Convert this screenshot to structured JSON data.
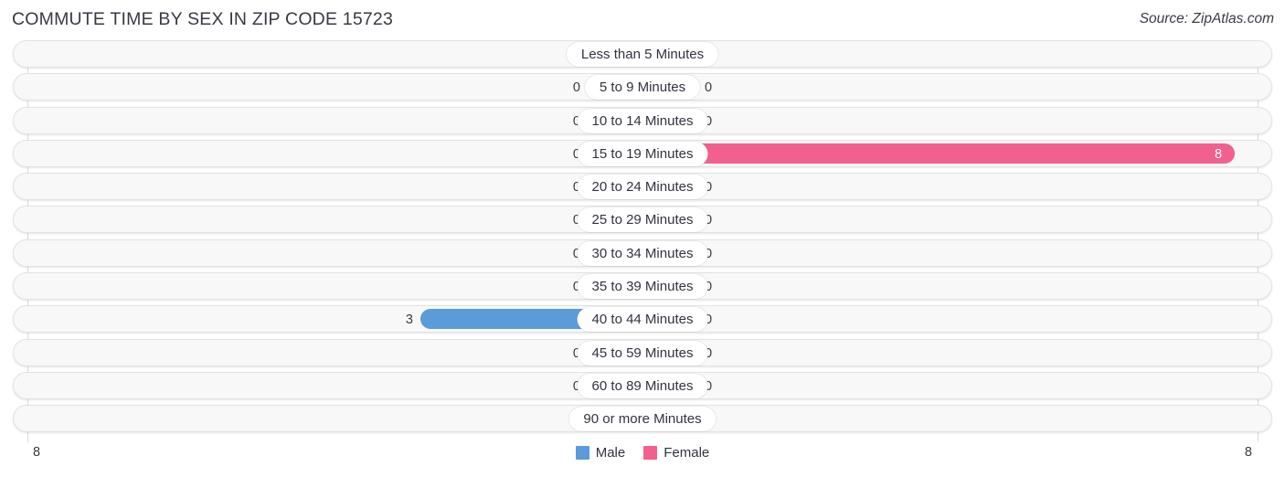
{
  "header": {
    "title": "COMMUTE TIME BY SEX IN ZIP CODE 15723",
    "source": "Source: ZipAtlas.com"
  },
  "legend": {
    "male_label": "Male",
    "female_label": "Female",
    "male_color": "#5b9bd9",
    "female_color": "#f2608f"
  },
  "axis": {
    "left_tick": "8",
    "right_tick": "8",
    "max": 8
  },
  "colors": {
    "male_zero": "#a3c4ea",
    "female_zero": "#f9a8c0",
    "male_filled": "#5b9bd9",
    "female_filled": "#f2608f",
    "row_background": "#f8f8f8",
    "row_border": "#e2e2e2"
  },
  "chart_data": {
    "type": "bar",
    "title": "COMMUTE TIME BY SEX IN ZIP CODE 15723",
    "subtitle": "Source: ZipAtlas.com",
    "orientation": "horizontal-diverging",
    "xlabel": "",
    "ylabel": "",
    "xlim": [
      8,
      8
    ],
    "grid": false,
    "legend_position": "bottom-center",
    "categories": [
      "Less than 5 Minutes",
      "5 to 9 Minutes",
      "10 to 14 Minutes",
      "15 to 19 Minutes",
      "20 to 24 Minutes",
      "25 to 29 Minutes",
      "30 to 34 Minutes",
      "35 to 39 Minutes",
      "40 to 44 Minutes",
      "45 to 59 Minutes",
      "60 to 89 Minutes",
      "90 or more Minutes"
    ],
    "series": [
      {
        "name": "Male",
        "color": "#5b9bd9",
        "values": [
          0,
          0,
          0,
          0,
          0,
          0,
          0,
          0,
          3,
          0,
          0,
          0
        ]
      },
      {
        "name": "Female",
        "color": "#f2608f",
        "values": [
          0,
          0,
          0,
          8,
          0,
          0,
          0,
          0,
          0,
          0,
          0,
          0
        ]
      }
    ]
  },
  "rows": [
    {
      "label": "Less than 5 Minutes",
      "male": "0",
      "female": "0"
    },
    {
      "label": "5 to 9 Minutes",
      "male": "0",
      "female": "0"
    },
    {
      "label": "10 to 14 Minutes",
      "male": "0",
      "female": "0"
    },
    {
      "label": "15 to 19 Minutes",
      "male": "0",
      "female": "8"
    },
    {
      "label": "20 to 24 Minutes",
      "male": "0",
      "female": "0"
    },
    {
      "label": "25 to 29 Minutes",
      "male": "0",
      "female": "0"
    },
    {
      "label": "30 to 34 Minutes",
      "male": "0",
      "female": "0"
    },
    {
      "label": "35 to 39 Minutes",
      "male": "0",
      "female": "0"
    },
    {
      "label": "40 to 44 Minutes",
      "male": "3",
      "female": "0"
    },
    {
      "label": "45 to 59 Minutes",
      "male": "0",
      "female": "0"
    },
    {
      "label": "60 to 89 Minutes",
      "male": "0",
      "female": "0"
    },
    {
      "label": "90 or more Minutes",
      "male": "0",
      "female": "0"
    }
  ]
}
